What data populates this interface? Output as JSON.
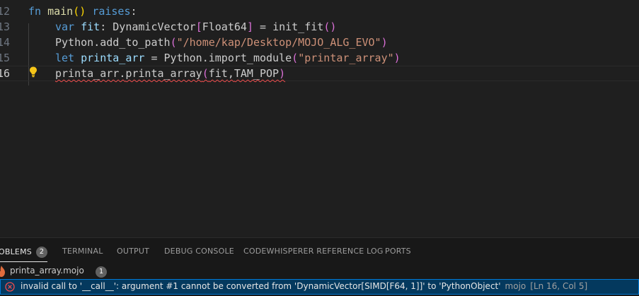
{
  "editor": {
    "lines": [
      {
        "number": "12",
        "tokens": [
          {
            "t": "fn ",
            "c": "kw"
          },
          {
            "t": "main",
            "c": "fn"
          },
          {
            "t": "()",
            "c": "p1"
          },
          {
            "t": " ",
            "c": "plain"
          },
          {
            "t": "raises",
            "c": "kw"
          },
          {
            "t": ":",
            "c": "plain"
          }
        ]
      },
      {
        "number": "13",
        "tokens": [
          {
            "t": "var ",
            "c": "kw"
          },
          {
            "t": "fit",
            "c": "var"
          },
          {
            "t": ": ",
            "c": "plain"
          },
          {
            "t": "DynamicVector",
            "c": "plain"
          },
          {
            "t": "[",
            "c": "p2"
          },
          {
            "t": "Float64",
            "c": "plain"
          },
          {
            "t": "]",
            "c": "p2"
          },
          {
            "t": " = ",
            "c": "plain"
          },
          {
            "t": "init_fit",
            "c": "plain"
          },
          {
            "t": "()",
            "c": "p2"
          }
        ]
      },
      {
        "number": "14",
        "tokens": [
          {
            "t": "Python",
            "c": "plain"
          },
          {
            "t": ".",
            "c": "plain"
          },
          {
            "t": "add_to_path",
            "c": "plain"
          },
          {
            "t": "(",
            "c": "p2"
          },
          {
            "t": "\"/home/kap/Desktop/MOJO_ALG_EVO\"",
            "c": "str"
          },
          {
            "t": ")",
            "c": "p2"
          }
        ]
      },
      {
        "number": "15",
        "tokens": [
          {
            "t": "let ",
            "c": "kw"
          },
          {
            "t": "printa_arr",
            "c": "var"
          },
          {
            "t": " = ",
            "c": "plain"
          },
          {
            "t": "Python",
            "c": "plain"
          },
          {
            "t": ".",
            "c": "plain"
          },
          {
            "t": "import_module",
            "c": "plain"
          },
          {
            "t": "(",
            "c": "p2"
          },
          {
            "t": "\"printar_array\"",
            "c": "str"
          },
          {
            "t": ")",
            "c": "p2"
          }
        ]
      },
      {
        "number": "16",
        "tokens": [
          {
            "t": "printa_arr",
            "c": "plain"
          },
          {
            "t": ".",
            "c": "plain"
          },
          {
            "t": "printa_array",
            "c": "plain"
          },
          {
            "t": "(",
            "c": "p2"
          },
          {
            "t": "fit",
            "c": "plain"
          },
          {
            "t": ",",
            "c": "plain"
          },
          {
            "t": "TAM_POP",
            "c": "plain"
          },
          {
            "t": ")",
            "c": "p2"
          }
        ]
      }
    ]
  },
  "panel": {
    "tabs": [
      {
        "label": "OBLEMS",
        "badge": "2"
      },
      {
        "label": "TERMINAL"
      },
      {
        "label": "OUTPUT"
      },
      {
        "label": "DEBUG CONSOLE"
      },
      {
        "label": "CODEWHISPERER REFERENCE LOG"
      },
      {
        "label": "PORTS"
      }
    ],
    "file": {
      "name": "printa_array.mojo",
      "count": "1"
    },
    "error": {
      "message": "invalid call to '__call__': argument #1 cannot be converted from 'DynamicVector[SIMD[F64, 1]]' to 'PythonObject'",
      "source": "mojo",
      "position": "[Ln 16, Col 5]"
    }
  },
  "colors": {
    "error_icon": "#f14c4c",
    "selection": "#04395e",
    "focus_border": "#0078d4",
    "file_icon": "#e06c3c"
  }
}
